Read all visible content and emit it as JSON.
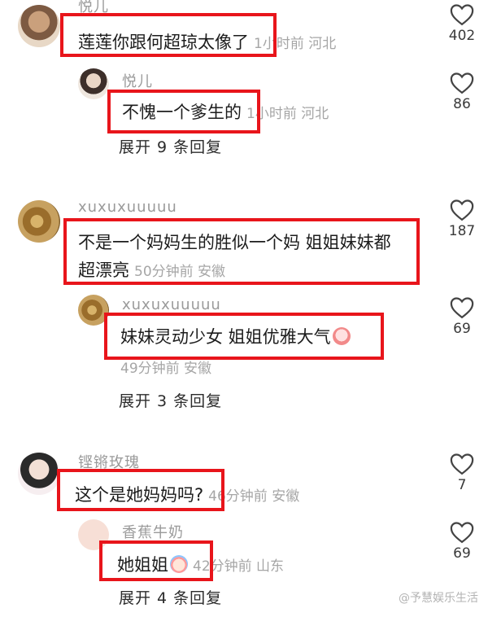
{
  "comments": [
    {
      "username": "悦儿",
      "text": "莲莲你跟何超琼太像了",
      "meta": "1小时前 河北",
      "likes": "402",
      "replies": [
        {
          "username": "悦儿",
          "text": "不愧一个爹生的",
          "meta": "1小时前 河北",
          "likes": "86"
        }
      ],
      "expand_label": "展开 9 条回复"
    },
    {
      "username": "xuxuxuuuuu",
      "text_line1": "不是一个妈妈生的胜似一个妈 姐姐妹妹都",
      "text_line2": "超漂亮",
      "meta": "50分钟前 安徽",
      "likes": "187",
      "replies": [
        {
          "username": "xuxuxuuuuu",
          "text": "妹妹灵动少女 姐姐优雅大气",
          "meta": "49分钟前 安徽",
          "likes": "69"
        }
      ],
      "expand_label": "展开 3 条回复"
    },
    {
      "username": "铿锵玫瑰",
      "text": "这个是她妈妈吗?",
      "meta": "46分钟前 安徽",
      "likes": "7",
      "replies": [
        {
          "username": "香蕉牛奶",
          "text": "她姐姐",
          "meta": "42分钟前 山东",
          "likes": "69"
        }
      ],
      "expand_label": "展开 4 条回复"
    }
  ],
  "icons": {
    "like": "heart-outline-icon",
    "emoji_smile": "blush-emoji-icon",
    "emoji_cry": "crying-emoji-icon"
  },
  "colors": {
    "highlight": "#e8151b",
    "meta": "#a6a6a6"
  },
  "watermark": "@予慧娱乐生活"
}
